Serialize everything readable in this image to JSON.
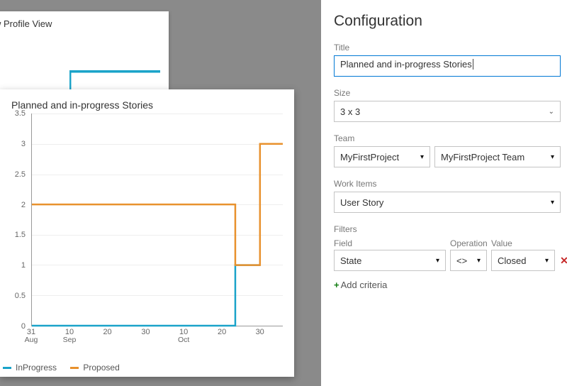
{
  "ghost_title": "w Profile View",
  "chart_data": {
    "type": "line",
    "title": "Planned and in-progress Stories",
    "xlabel": "",
    "ylabel": "",
    "ylim": [
      0,
      3.5
    ],
    "y_ticks": [
      "0",
      "0.5",
      "1",
      "1.5",
      "2",
      "2.5",
      "3",
      "3.5"
    ],
    "x_tick_labels": [
      {
        "top": "31",
        "bottom": "Aug"
      },
      {
        "top": "10",
        "bottom": "Sep"
      },
      {
        "top": "20",
        "bottom": ""
      },
      {
        "top": "30",
        "bottom": ""
      },
      {
        "top": "10",
        "bottom": "Oct"
      },
      {
        "top": "20",
        "bottom": ""
      },
      {
        "top": "30",
        "bottom": ""
      }
    ],
    "x": [
      0,
      10,
      20,
      30,
      40,
      50,
      53,
      53.5,
      60,
      66
    ],
    "series": [
      {
        "name": "InProgress",
        "color": "#1aa3c9",
        "values": [
          0,
          0,
          0,
          0,
          0,
          0,
          0,
          1,
          1,
          null
        ]
      },
      {
        "name": "Proposed",
        "color": "#e8912d",
        "values": [
          2,
          2,
          2,
          2,
          2,
          2,
          2,
          1,
          3,
          3
        ]
      }
    ],
    "x_range": [
      0,
      66
    ]
  },
  "config": {
    "heading": "Configuration",
    "title_label": "Title",
    "title_value": "Planned and in-progress Stories",
    "size_label": "Size",
    "size_value": "3 x 3",
    "team_label": "Team",
    "team_project": "MyFirstProject",
    "team_name": "MyFirstProject Team",
    "work_items_label": "Work Items",
    "work_items_value": "User Story",
    "filters_label": "Filters",
    "filters_headers": {
      "field": "Field",
      "op": "Operation",
      "value": "Value"
    },
    "filter_row": {
      "field": "State",
      "op": "<>",
      "value": "Closed"
    },
    "add_criteria_label": "Add criteria"
  }
}
